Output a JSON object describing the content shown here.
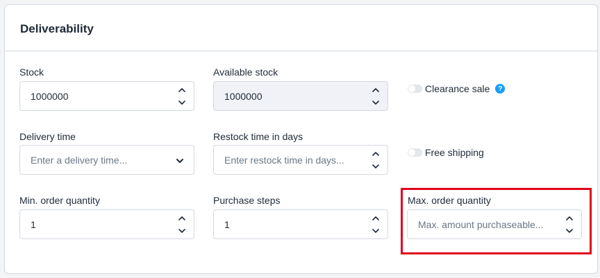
{
  "card": {
    "title": "Deliverability"
  },
  "fields": {
    "stock": {
      "label": "Stock",
      "value": "1000000"
    },
    "available_stock": {
      "label": "Available stock",
      "value": "1000000"
    },
    "delivery_time": {
      "label": "Delivery time",
      "placeholder": "Enter a delivery time..."
    },
    "restock_time": {
      "label": "Restock time in days",
      "placeholder": "Enter restock time in days..."
    },
    "min_order": {
      "label": "Min. order quantity",
      "value": "1"
    },
    "purchase_steps": {
      "label": "Purchase steps",
      "value": "1"
    },
    "max_order": {
      "label": "Max. order quantity",
      "placeholder": "Max. amount purchaseable..."
    }
  },
  "toggles": {
    "clearance_sale": {
      "label": "Clearance sale",
      "help": "?"
    },
    "free_shipping": {
      "label": "Free shipping"
    }
  },
  "colors": {
    "accent": "#189eff",
    "highlight": "#e0001a",
    "border": "#d1d9e0",
    "disabled_bg": "#f0f2f7"
  },
  "icons": [
    "chevron-up-icon",
    "chevron-down-icon",
    "question-icon"
  ]
}
